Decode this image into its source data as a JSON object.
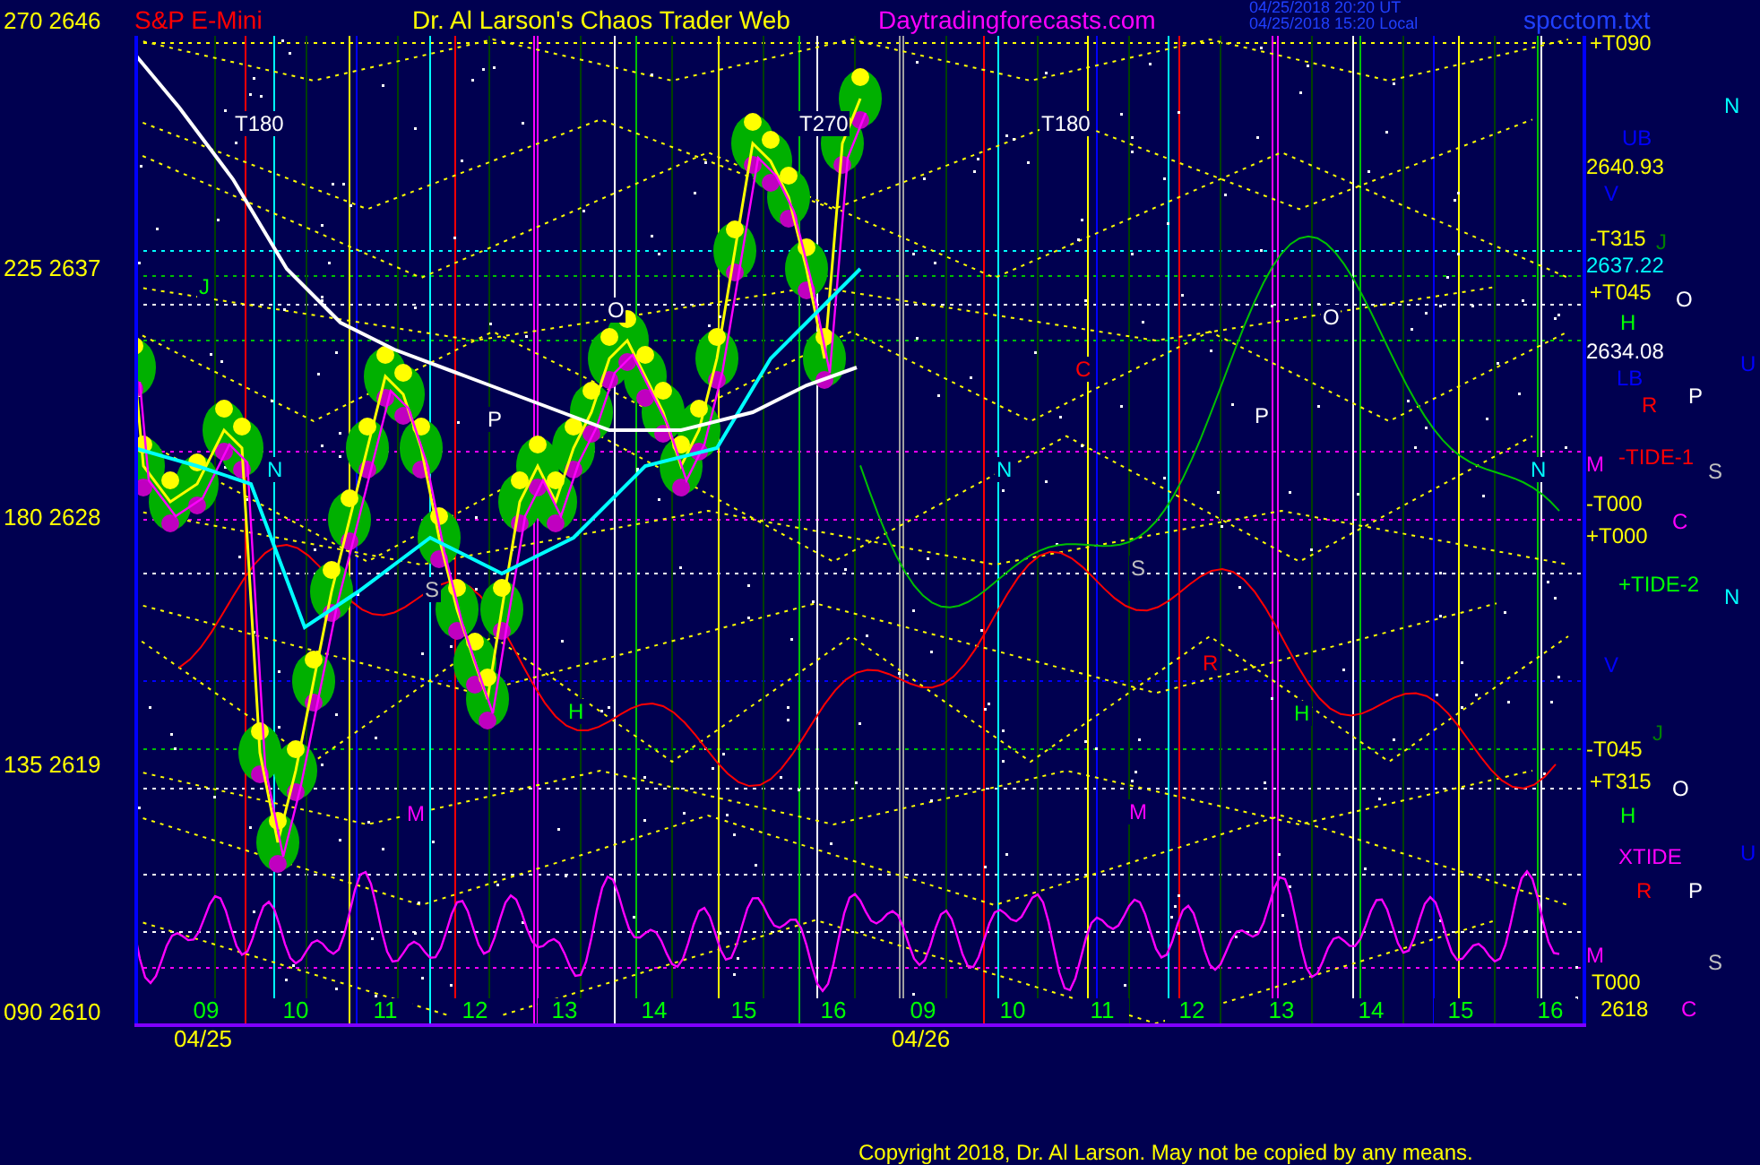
{
  "header": {
    "symbol": "S&P E-Mini",
    "title": "Dr. Al Larson's Chaos Trader Web",
    "website": "Daytradingforecasts.com",
    "timestamps": [
      "04/25/2018 20:20 UT",
      "04/25/2018 15:20 Local"
    ],
    "file": "spcctom.txt"
  },
  "y_axis": [
    "270 2646",
    "225 2637",
    "180 2628",
    "135 2619",
    "090 2610"
  ],
  "chart_labels": [
    {
      "text": "T180",
      "color": "#ffffff"
    },
    {
      "text": "T270",
      "color": "#ffffff"
    },
    {
      "text": "T180",
      "color": "#ffffff"
    },
    {
      "text": "N",
      "color": "#00ffff"
    },
    {
      "text": "N",
      "color": "#00ffff"
    },
    {
      "text": "N",
      "color": "#00ffff"
    },
    {
      "text": "O",
      "color": "#ffffff"
    },
    {
      "text": "O",
      "color": "#ffffff"
    },
    {
      "text": "P",
      "color": "#ffffff"
    },
    {
      "text": "P",
      "color": "#ffffff"
    },
    {
      "text": "S",
      "color": "#c0c0c0"
    },
    {
      "text": "S",
      "color": "#c0c0c0"
    },
    {
      "text": "H",
      "color": "#00ff00"
    },
    {
      "text": "H",
      "color": "#00ff00"
    },
    {
      "text": "M",
      "color": "#ff00ff"
    },
    {
      "text": "M",
      "color": "#ff00ff"
    },
    {
      "text": "C",
      "color": "#ff0000"
    },
    {
      "text": "R",
      "color": "#ff0000"
    },
    {
      "text": "J",
      "color": "#00ff00"
    }
  ],
  "right_labels": [
    {
      "text": "+T090",
      "color": "#ffff00"
    },
    {
      "text": "N",
      "color": "#00ffff"
    },
    {
      "text": "UB",
      "color": "#0000ff"
    },
    {
      "text": "2640.93",
      "color": "#ffff00"
    },
    {
      "text": "V",
      "color": "#0000ff"
    },
    {
      "text": "-T315",
      "color": "#ffff00"
    },
    {
      "text": "J",
      "color": "#008000"
    },
    {
      "text": "2637.22",
      "color": "#00ffff"
    },
    {
      "text": "+T045",
      "color": "#ffff00"
    },
    {
      "text": "O",
      "color": "#ffffff"
    },
    {
      "text": "H",
      "color": "#00ff00"
    },
    {
      "text": "2634.08",
      "color": "#ffffff"
    },
    {
      "text": "U",
      "color": "#0000ff"
    },
    {
      "text": "LB",
      "color": "#0000ff"
    },
    {
      "text": "R",
      "color": "#ff0000"
    },
    {
      "text": "P",
      "color": "#ffffff"
    },
    {
      "text": "-TIDE-1",
      "color": "#ff0000"
    },
    {
      "text": "M",
      "color": "#ff00ff"
    },
    {
      "text": "S",
      "color": "#c0c0c0"
    },
    {
      "text": "-T000",
      "color": "#ffff00"
    },
    {
      "text": "C",
      "color": "#ff00ff"
    },
    {
      "text": "+T000",
      "color": "#ffff00"
    },
    {
      "text": "+TIDE-2",
      "color": "#00ff00"
    },
    {
      "text": "N",
      "color": "#00ffff"
    },
    {
      "text": "V",
      "color": "#0000ff"
    },
    {
      "text": "J",
      "color": "#008000"
    },
    {
      "text": "-T045",
      "color": "#ffff00"
    },
    {
      "text": "+T315",
      "color": "#ffff00"
    },
    {
      "text": "O",
      "color": "#ffffff"
    },
    {
      "text": "H",
      "color": "#00ff00"
    },
    {
      "text": "XTIDE",
      "color": "#ff00ff"
    },
    {
      "text": "U",
      "color": "#0000ff"
    },
    {
      "text": "R",
      "color": "#ff0000"
    },
    {
      "text": "P",
      "color": "#ffffff"
    },
    {
      "text": "M",
      "color": "#ff00ff"
    },
    {
      "text": "S",
      "color": "#c0c0c0"
    },
    {
      "text": "T000",
      "color": "#ffff00"
    },
    {
      "text": "2618",
      "color": "#ffff00"
    },
    {
      "text": "C",
      "color": "#ff00ff"
    }
  ],
  "hours": [
    "09",
    "10",
    "11",
    "12",
    "13",
    "14",
    "15",
    "16",
    "09",
    "10",
    "11",
    "12",
    "13",
    "14",
    "15",
    "16"
  ],
  "dates": [
    "04/25",
    "04/26"
  ],
  "copyright": "Copyright 2018, Dr. Al Larson. May not be copied by any means."
}
